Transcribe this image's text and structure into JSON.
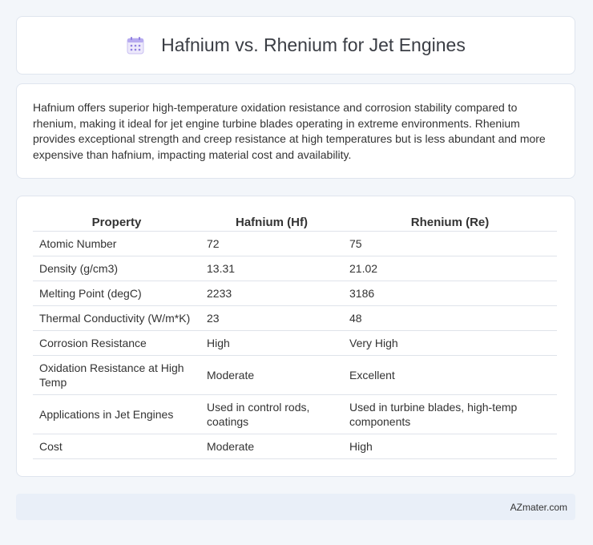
{
  "header": {
    "icon": "calendar-icon",
    "title": "Hafnium vs. Rhenium for Jet Engines"
  },
  "intro": {
    "text": "Hafnium offers superior high-temperature oxidation resistance and corrosion stability compared to rhenium, making it ideal for jet engine turbine blades operating in extreme environments. Rhenium provides exceptional strength and creep resistance at high temperatures but is less abundant and more expensive than hafnium, impacting material cost and availability."
  },
  "table": {
    "headers": [
      "Property",
      "Hafnium (Hf)",
      "Rhenium (Re)"
    ],
    "rows": [
      [
        "Atomic Number",
        "72",
        "75"
      ],
      [
        "Density (g/cm3)",
        "13.31",
        "21.02"
      ],
      [
        "Melting Point (degC)",
        "2233",
        "3186"
      ],
      [
        "Thermal Conductivity (W/m*K)",
        "23",
        "48"
      ],
      [
        "Corrosion Resistance",
        "High",
        "Very High"
      ],
      [
        "Oxidation Resistance at High Temp",
        "Moderate",
        "Excellent"
      ],
      [
        "Applications in Jet Engines",
        "Used in control rods, coatings",
        "Used in turbine blades, high-temp components"
      ],
      [
        "Cost",
        "Moderate",
        "High"
      ]
    ]
  },
  "footer": {
    "text": "AZmater.com"
  },
  "colors": {
    "background": "#f3f6fa",
    "card": "#ffffff",
    "footer_bg": "#e9eff8",
    "icon_accent": "#8f7fe0"
  }
}
